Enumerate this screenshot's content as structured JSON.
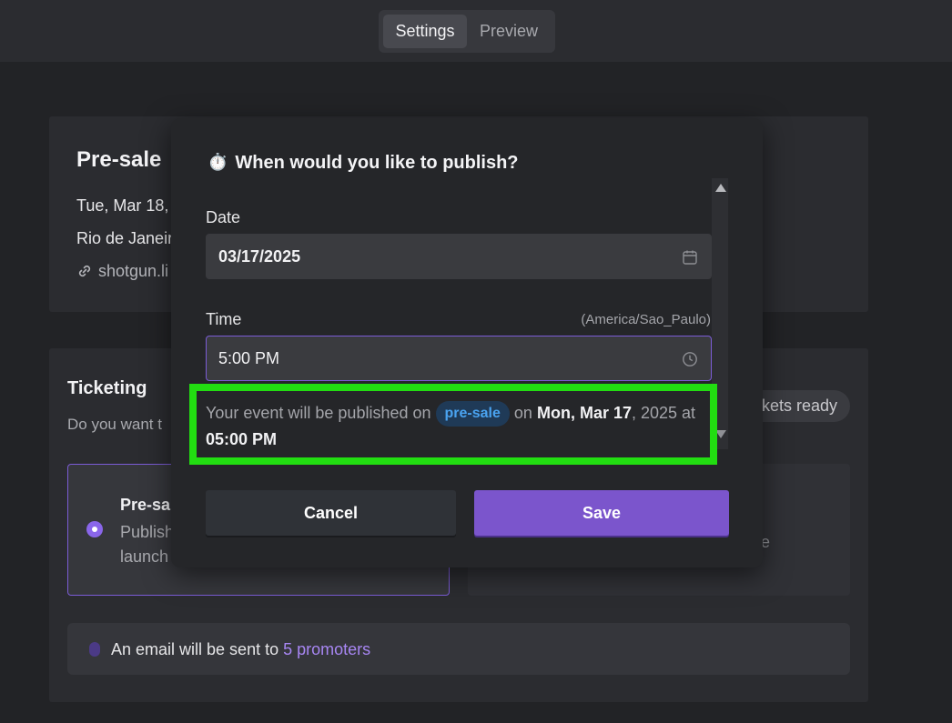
{
  "tabs": {
    "settings": "Settings",
    "preview": "Preview"
  },
  "event": {
    "title": "Pre-sale",
    "date": "Tue, Mar 18,",
    "location": "Rio de Janeir",
    "link": "shotgun.li"
  },
  "ticketing": {
    "title": "Ticketing",
    "question": "Do you want t",
    "chip": "kets ready",
    "option_presale": {
      "title": "Pre-sa",
      "desc_line1": "Publish",
      "desc_line2": "launch"
    },
    "option_other_tail": "e",
    "email": {
      "prefix": "An email will be sent to",
      "link": "5 promoters"
    }
  },
  "modal": {
    "title": "When would you like to publish?",
    "title_icon": "timer-icon",
    "date_label": "Date",
    "date_value": "03/17/2025",
    "time_label": "Time",
    "timezone": "(America/Sao_Paulo)",
    "time_value": "5:00 PM",
    "notice": {
      "prefix": "Your event will be published on",
      "pill": "pre-sale",
      "on": "on",
      "date_bold": "Mon, Mar 17",
      "year": ", 2025 at",
      "time_bold": "05:00 PM"
    },
    "cancel_label": "Cancel",
    "save_label": "Save"
  },
  "colors": {
    "accent": "#7b55cc",
    "highlight": "#22dd11",
    "pill_bg": "#1f3a57",
    "pill_text": "#4aa3f0"
  }
}
